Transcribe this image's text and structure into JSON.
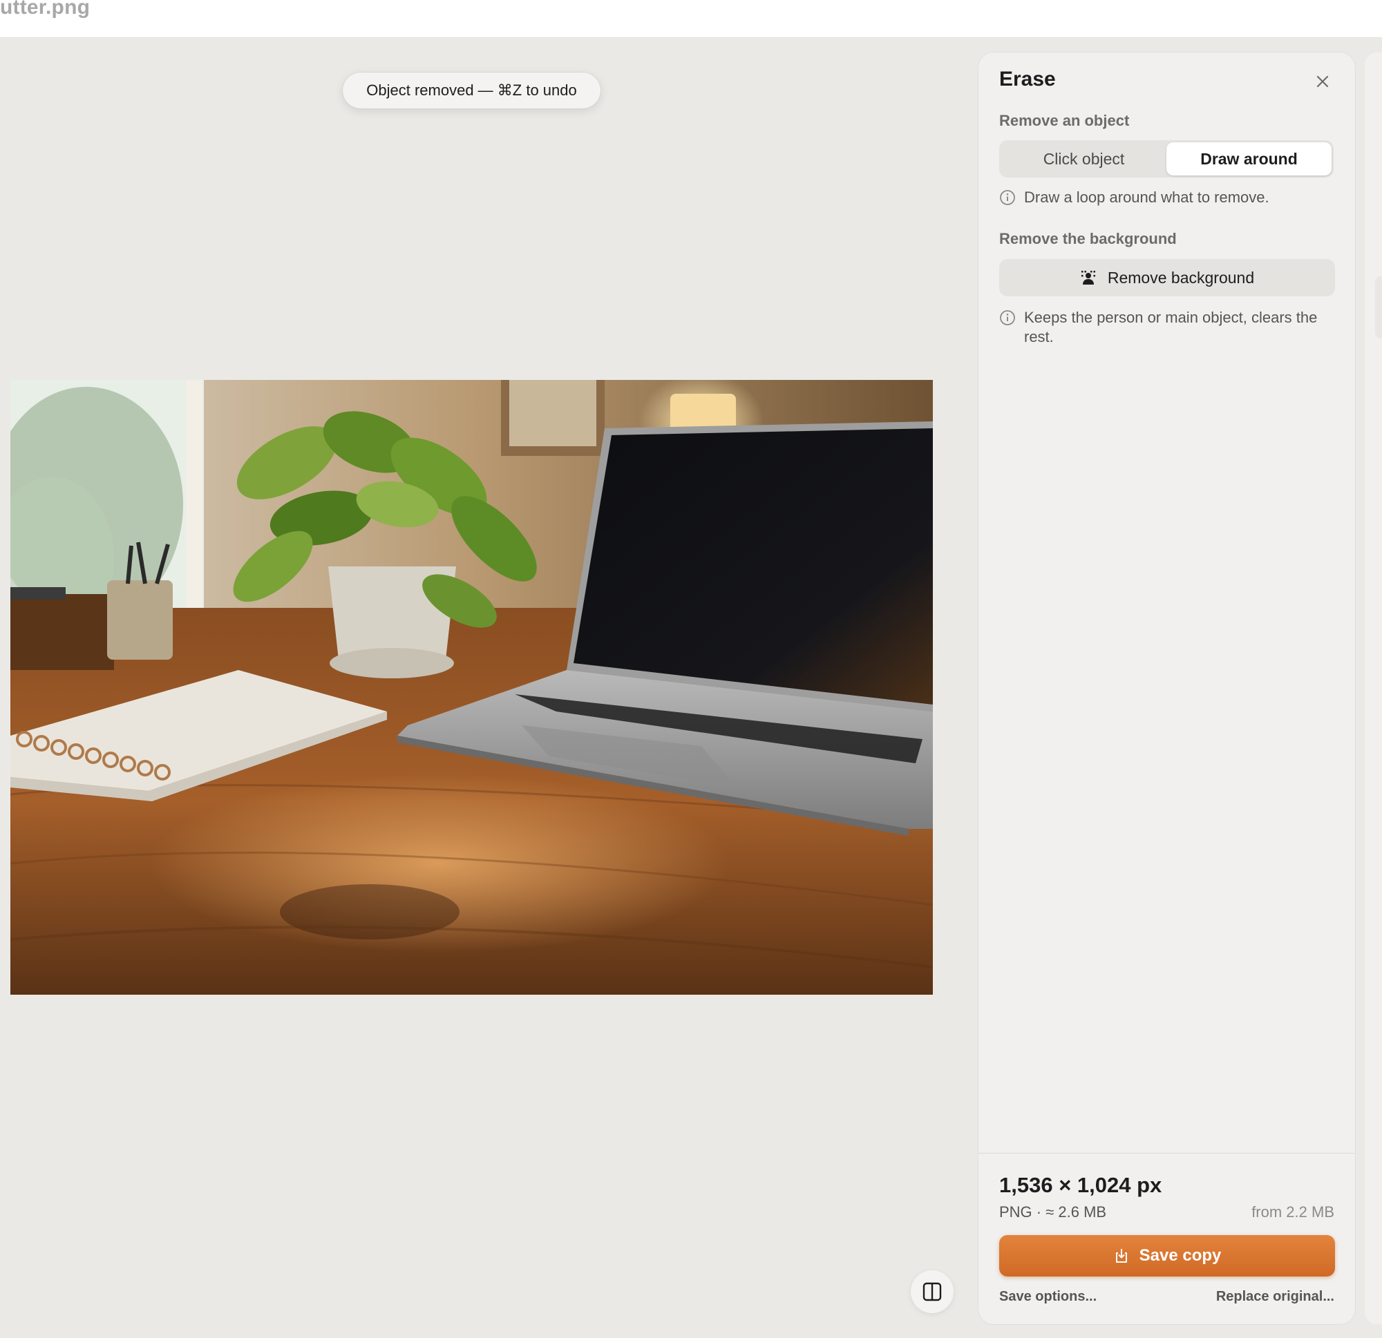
{
  "window": {
    "file_name": "utter.png"
  },
  "toast": {
    "text": "Object removed — ⌘Z to undo"
  },
  "panel": {
    "title": "Erase",
    "close_icon": "close-icon",
    "remove_object": {
      "label": "Remove an object",
      "modes": [
        {
          "label": "Click object",
          "active": false
        },
        {
          "label": "Draw around",
          "active": true
        }
      ],
      "hint": "Draw a loop around what to remove."
    },
    "remove_background": {
      "label": "Remove the background",
      "button_label": "Remove background",
      "button_icon": "person-cutout-icon",
      "hint": "Keeps the person or main object, clears the rest."
    },
    "info": {
      "dimensions": "1,536 × 1,024 px",
      "format_size": "PNG · ≈ 2.6 MB",
      "original_size": "from 2.2 MB"
    },
    "actions": {
      "save_label": "Save copy",
      "save_icon": "save-download-icon",
      "save_options_label": "Save options...",
      "replace_label": "Replace original..."
    }
  },
  "canvas": {
    "compare_icon": "split-view-icon",
    "accent_color": "#d9752f"
  }
}
